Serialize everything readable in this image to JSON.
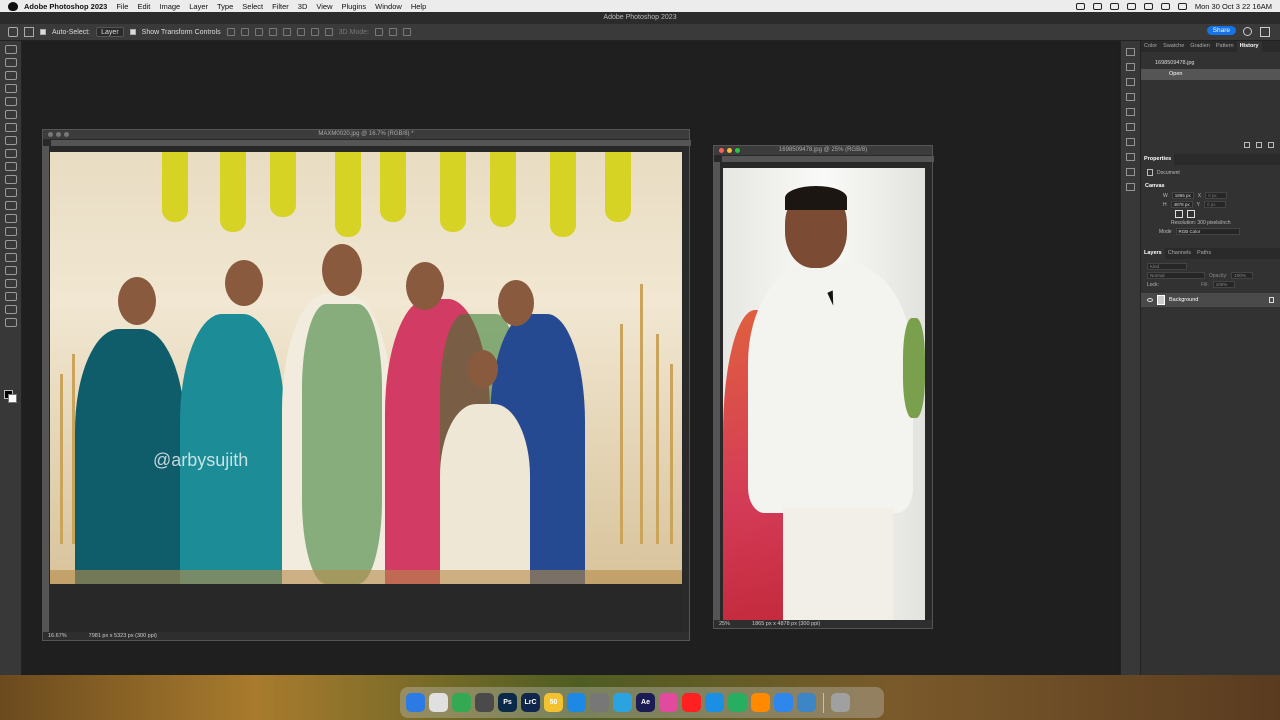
{
  "menubar": {
    "app_name": "Adobe Photoshop 2023",
    "menus": [
      "File",
      "Edit",
      "Image",
      "Layer",
      "Type",
      "Select",
      "Filter",
      "3D",
      "View",
      "Plugins",
      "Window",
      "Help"
    ],
    "clock": "Mon 30 Oct  3 22 16AM"
  },
  "window_title": "Adobe Photoshop 2023",
  "options_bar": {
    "auto_select_label": "Auto-Select:",
    "auto_select_value": "Layer",
    "show_transform_label": "Show Transform Controls",
    "mode_3d_label": "3D Mode:",
    "share_label": "Share"
  },
  "doc1": {
    "title": "MAXM0020.jpg @ 16.7% (RGB/8) *",
    "zoom": "16.67%",
    "dimensions": "7981 px x 5323 px (300 ppi)",
    "watermark": "@arbysujith",
    "ruler_ticks": [
      "400",
      "600",
      "800",
      "1000",
      "1200",
      "1400",
      "1600",
      "1800",
      "2000",
      "2200",
      "2400",
      "2600",
      "2800",
      "3000",
      "3200",
      "3400",
      "3600",
      "3800",
      "4000",
      "4200",
      "4400",
      "4600",
      "4800",
      "5000",
      "5200",
      "5400",
      "5600",
      "5800",
      "6000",
      "6200",
      "6400",
      "6600",
      "6800",
      "7000",
      "7200",
      "7400",
      "7600"
    ]
  },
  "doc2": {
    "title": "1698509478.jpg @ 25% (RGB/8)",
    "zoom": "25%",
    "dimensions": "1865 px x 4878 px (300 ppi)",
    "ruler_ticks": [
      "0",
      "200",
      "400",
      "600",
      "800",
      "1000",
      "1200",
      "1400",
      "1600",
      "1800"
    ]
  },
  "panels": {
    "top_tabs": [
      "Color",
      "Swatche",
      "Gradien",
      "Pattern",
      "History"
    ],
    "history_doc": "1698509478.jpg",
    "history_items": [
      "Open"
    ],
    "properties_title": "Properties",
    "properties_type": "Document",
    "canvas_label": "Canvas",
    "w_label": "W",
    "w_value": "1865 px",
    "x_label": "X",
    "x_value": "0 px",
    "h_label": "H",
    "h_value": "4878 px",
    "y_label": "Y",
    "y_value": "0 px",
    "resolution": "Resolution: 300 pixels/inch",
    "mode_label": "Mode",
    "mode_value": "RGB Color",
    "layer_tabs": [
      "Layers",
      "Channels",
      "Paths"
    ],
    "kind_label": "Kind",
    "blend_mode": "Normal",
    "opacity_label": "Opacity:",
    "opacity_value": "100%",
    "lock_label": "Lock:",
    "fill_label": "Fill:",
    "fill_value": "100%",
    "layer_name": "Background"
  },
  "dock": {
    "apps": [
      {
        "label": "",
        "color": "#2c7be5"
      },
      {
        "label": "",
        "color": "#e0e0e0"
      },
      {
        "label": "",
        "color": "#34a853"
      },
      {
        "label": "",
        "color": "#4a4a4a"
      },
      {
        "label": "Ps",
        "color": "#0b2a4a"
      },
      {
        "label": "LrC",
        "color": "#10264a"
      },
      {
        "label": "50",
        "color": "#f2c230"
      },
      {
        "label": "",
        "color": "#1e88e5"
      },
      {
        "label": "",
        "color": "#777777"
      },
      {
        "label": "",
        "color": "#2aa3e0"
      },
      {
        "label": "Ae",
        "color": "#1c1c55"
      },
      {
        "label": "",
        "color": "#e24a9e"
      },
      {
        "label": "",
        "color": "#ff2020"
      },
      {
        "label": "",
        "color": "#1a8fe3"
      },
      {
        "label": "",
        "color": "#27ae60"
      },
      {
        "label": "",
        "color": "#ff8a00"
      },
      {
        "label": "",
        "color": "#2f86eb"
      },
      {
        "label": "",
        "color": "#3d86c6"
      },
      {
        "label": "",
        "color": "#a0a0a0"
      }
    ]
  }
}
